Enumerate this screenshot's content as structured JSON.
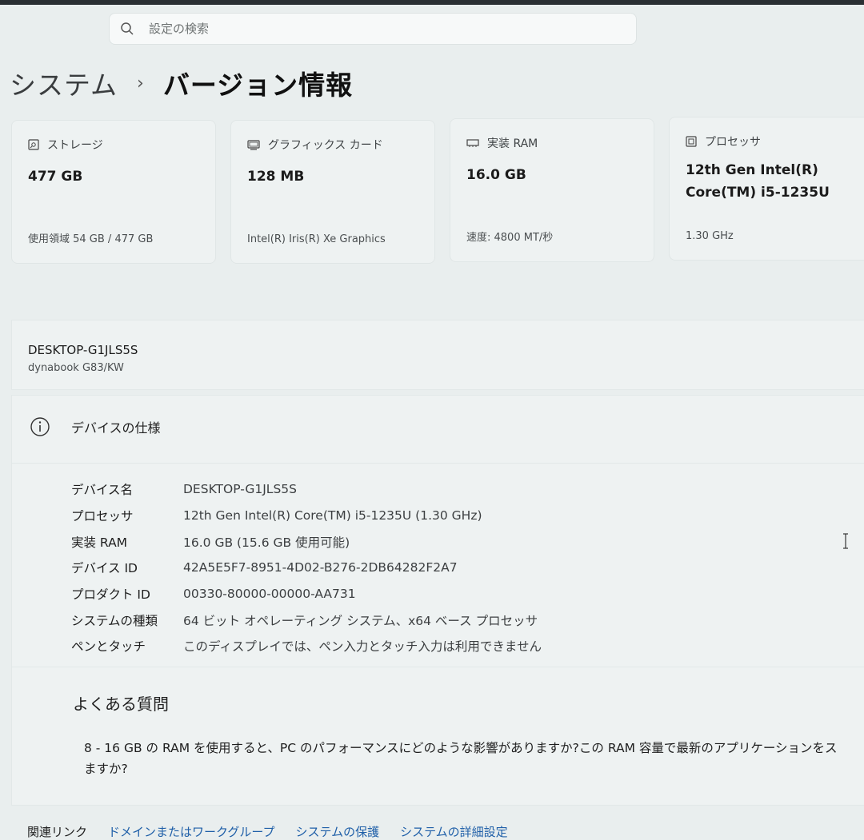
{
  "search": {
    "placeholder": "設定の検索"
  },
  "breadcrumb": {
    "parent": "システム",
    "separator": "›",
    "current": "バージョン情報"
  },
  "cards": {
    "storage": {
      "label": "ストレージ",
      "value": "477 GB",
      "detail": "使用領域 54 GB / 477 GB",
      "icon": "storage-icon"
    },
    "graphics": {
      "label": "グラフィックス カード",
      "value": "128 MB",
      "detail": "Intel(R) Iris(R) Xe Graphics",
      "icon": "graphics-card-icon"
    },
    "ram": {
      "label": "実装 RAM",
      "value": "16.0 GB",
      "detail": "速度: 4800 MT/秒",
      "icon": "ram-icon"
    },
    "processor": {
      "label": "プロセッサ",
      "value_line1": "12th Gen Intel(R)",
      "value_line2": "Core(TM) i5-1235U",
      "detail": "1.30 GHz",
      "icon": "processor-icon"
    }
  },
  "device": {
    "name": "DESKTOP-G1JLS5S",
    "model": "dynabook G83/KW"
  },
  "device_spec": {
    "title": "デバイスの仕様",
    "rows": [
      {
        "label": "デバイス名",
        "value": "DESKTOP-G1JLS5S"
      },
      {
        "label": "プロセッサ",
        "value": "12th Gen Intel(R) Core(TM) i5-1235U (1.30 GHz)"
      },
      {
        "label": "実装 RAM",
        "value": "16.0 GB (15.6 GB 使用可能)"
      },
      {
        "label": "デバイス ID",
        "value": "42A5E5F7-8951-4D02-B276-2DB64282F2A7"
      },
      {
        "label": "プロダクト ID",
        "value": "00330-80000-00000-AA731"
      },
      {
        "label": "システムの種類",
        "value": "64 ビット オペレーティング システム、x64 ベース プロセッサ"
      },
      {
        "label": "ペンとタッチ",
        "value": "このディスプレイでは、ペン入力とタッチ入力は利用できません"
      }
    ]
  },
  "faq": {
    "title": "よくある質問",
    "question_line1": "8 - 16 GB の RAM を使用すると、PC のパフォーマンスにどのような影響がありますか?この RAM 容量で最新のアプリケーションをス",
    "question_line2": "ますか?"
  },
  "related_links": {
    "label": "関連リンク",
    "items": [
      "ドメインまたはワークグループ",
      "システムの保護",
      "システムの詳細設定"
    ]
  }
}
